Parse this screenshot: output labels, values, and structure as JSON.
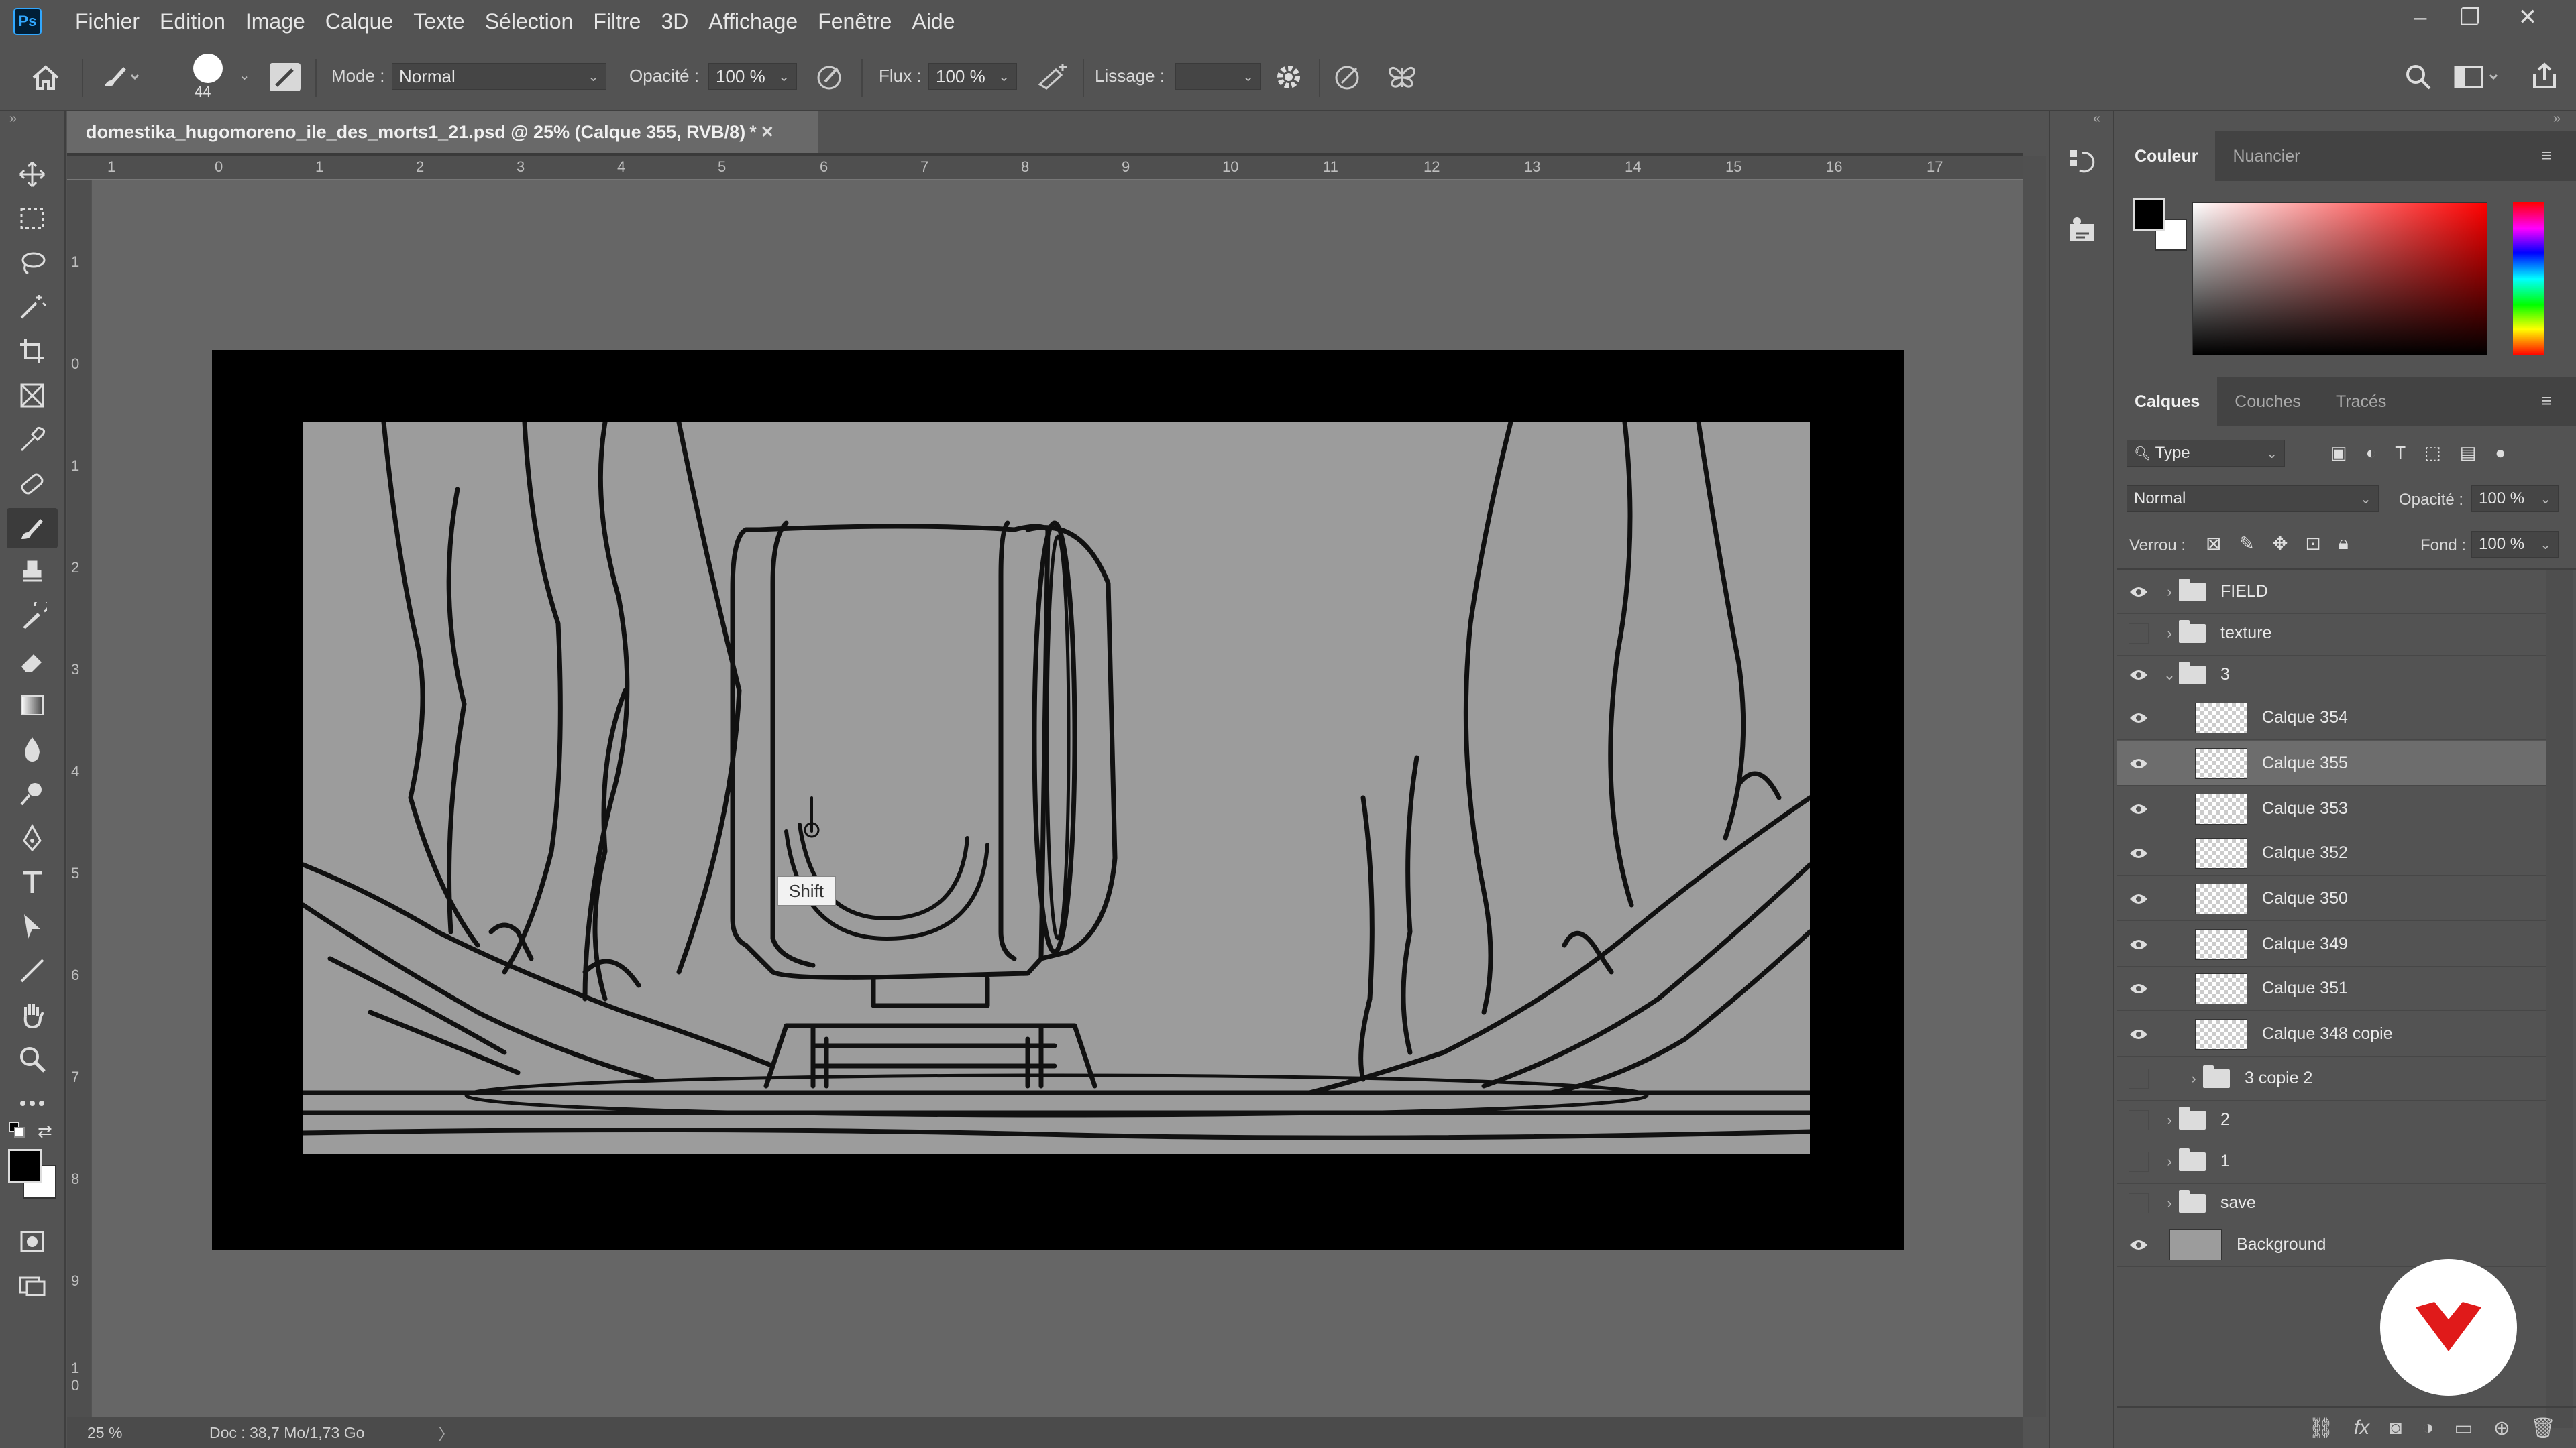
{
  "app": {
    "logo": "Ps"
  },
  "menu": [
    "Fichier",
    "Edition",
    "Image",
    "Calque",
    "Texte",
    "Sélection",
    "Filtre",
    "3D",
    "Affichage",
    "Fenêtre",
    "Aide"
  ],
  "window_controls": {
    "minimize": "–",
    "restore": "❐",
    "close": "✕"
  },
  "options": {
    "brush_size": "44",
    "mode_label": "Mode :",
    "mode_value": "Normal",
    "opacity_label": "Opacité :",
    "opacity_value": "100 %",
    "flow_label": "Flux :",
    "flow_value": "100 %",
    "smoothing_label": "Lissage :",
    "smoothing_value": ""
  },
  "document": {
    "tab_title": "domestika_hugomoreno_ile_des_morts1_21.psd @ 25% (Calque 355, RVB/8)",
    "tab_modified": "*",
    "zoom": "25 %",
    "doc_info": "Doc : 38,7 Mo/1,73 Go",
    "ruler_top": [
      "1",
      "0",
      "1",
      "2",
      "3",
      "4",
      "5",
      "6",
      "7",
      "8",
      "9",
      "10",
      "11",
      "12",
      "13",
      "14",
      "15",
      "16",
      "17"
    ],
    "ruler_left": [
      "1",
      "0",
      "1",
      "2",
      "3",
      "4",
      "5",
      "6",
      "7",
      "8",
      "9",
      "1 0"
    ],
    "tooltip": "Shift"
  },
  "color_panel": {
    "tabs": [
      "Couleur",
      "Nuancier"
    ],
    "foreground": "#000000",
    "background": "#ffffff"
  },
  "layers_panel": {
    "tabs": [
      "Calques",
      "Couches",
      "Tracés"
    ],
    "filter_value": "Type",
    "blend_mode": "Normal",
    "opacity_label": "Opacité :",
    "opacity_value": "100 %",
    "lock_label": "Verrou :",
    "fill_label": "Fond :",
    "fill_value": "100 %",
    "layers": [
      {
        "name": "FIELD",
        "kind": "folder",
        "visible": true,
        "expanded": false,
        "indent": 0
      },
      {
        "name": "texture",
        "kind": "folder",
        "visible": false,
        "expanded": false,
        "indent": 0
      },
      {
        "name": "3",
        "kind": "folder",
        "visible": true,
        "expanded": true,
        "indent": 0
      },
      {
        "name": "Calque 354",
        "kind": "layer",
        "visible": true,
        "indent": 1
      },
      {
        "name": "Calque 355",
        "kind": "layer",
        "visible": true,
        "indent": 1,
        "selected": true
      },
      {
        "name": "Calque 353",
        "kind": "layer",
        "visible": true,
        "indent": 1
      },
      {
        "name": "Calque 352",
        "kind": "layer",
        "visible": true,
        "indent": 1
      },
      {
        "name": "Calque 350",
        "kind": "layer",
        "visible": true,
        "indent": 1
      },
      {
        "name": "Calque 349",
        "kind": "layer",
        "visible": true,
        "indent": 1
      },
      {
        "name": "Calque 351",
        "kind": "layer",
        "visible": true,
        "indent": 1
      },
      {
        "name": "Calque 348 copie",
        "kind": "layer",
        "visible": true,
        "indent": 1
      },
      {
        "name": "3 copie 2",
        "kind": "folder",
        "visible": false,
        "expanded": false,
        "indent": 1
      },
      {
        "name": "2",
        "kind": "folder",
        "visible": false,
        "expanded": false,
        "indent": 0
      },
      {
        "name": "1",
        "kind": "folder",
        "visible": false,
        "expanded": false,
        "indent": 0
      },
      {
        "name": "save",
        "kind": "folder",
        "visible": false,
        "expanded": false,
        "indent": 0
      },
      {
        "name": "Background",
        "kind": "background",
        "visible": true,
        "indent": 0
      }
    ]
  },
  "colors": {
    "accent": "#31a8ff",
    "ui_bg": "#535353",
    "domestika_red": "#e01a1a"
  }
}
